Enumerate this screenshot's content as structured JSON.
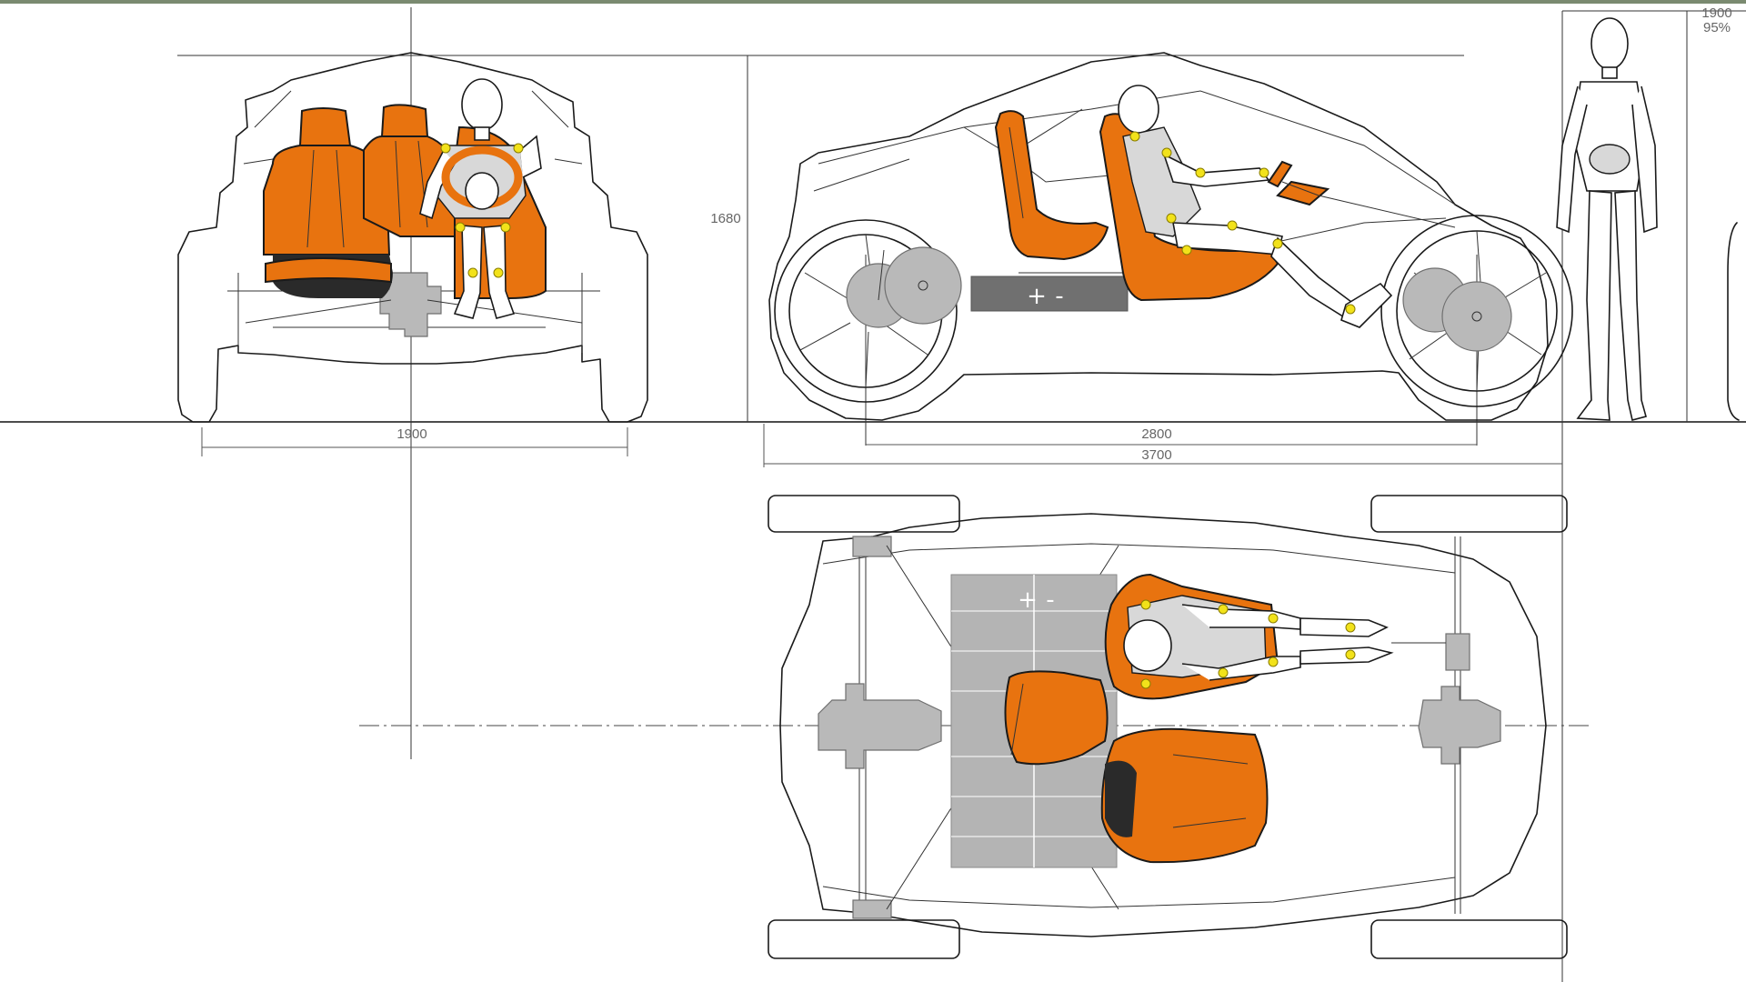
{
  "dimensions": {
    "front_track": "1900",
    "height": "1680",
    "wheelbase": "2800",
    "overall_length": "3700",
    "figure_height": "1900",
    "figure_percentile": "95%"
  },
  "battery": {
    "plus": "+",
    "minus": "-"
  },
  "colors": {
    "seat_orange": "#e8730f",
    "component_gray": "#b9b9b9",
    "battery_dark_gray": "#707070",
    "joint_yellow": "#f2e21a"
  }
}
